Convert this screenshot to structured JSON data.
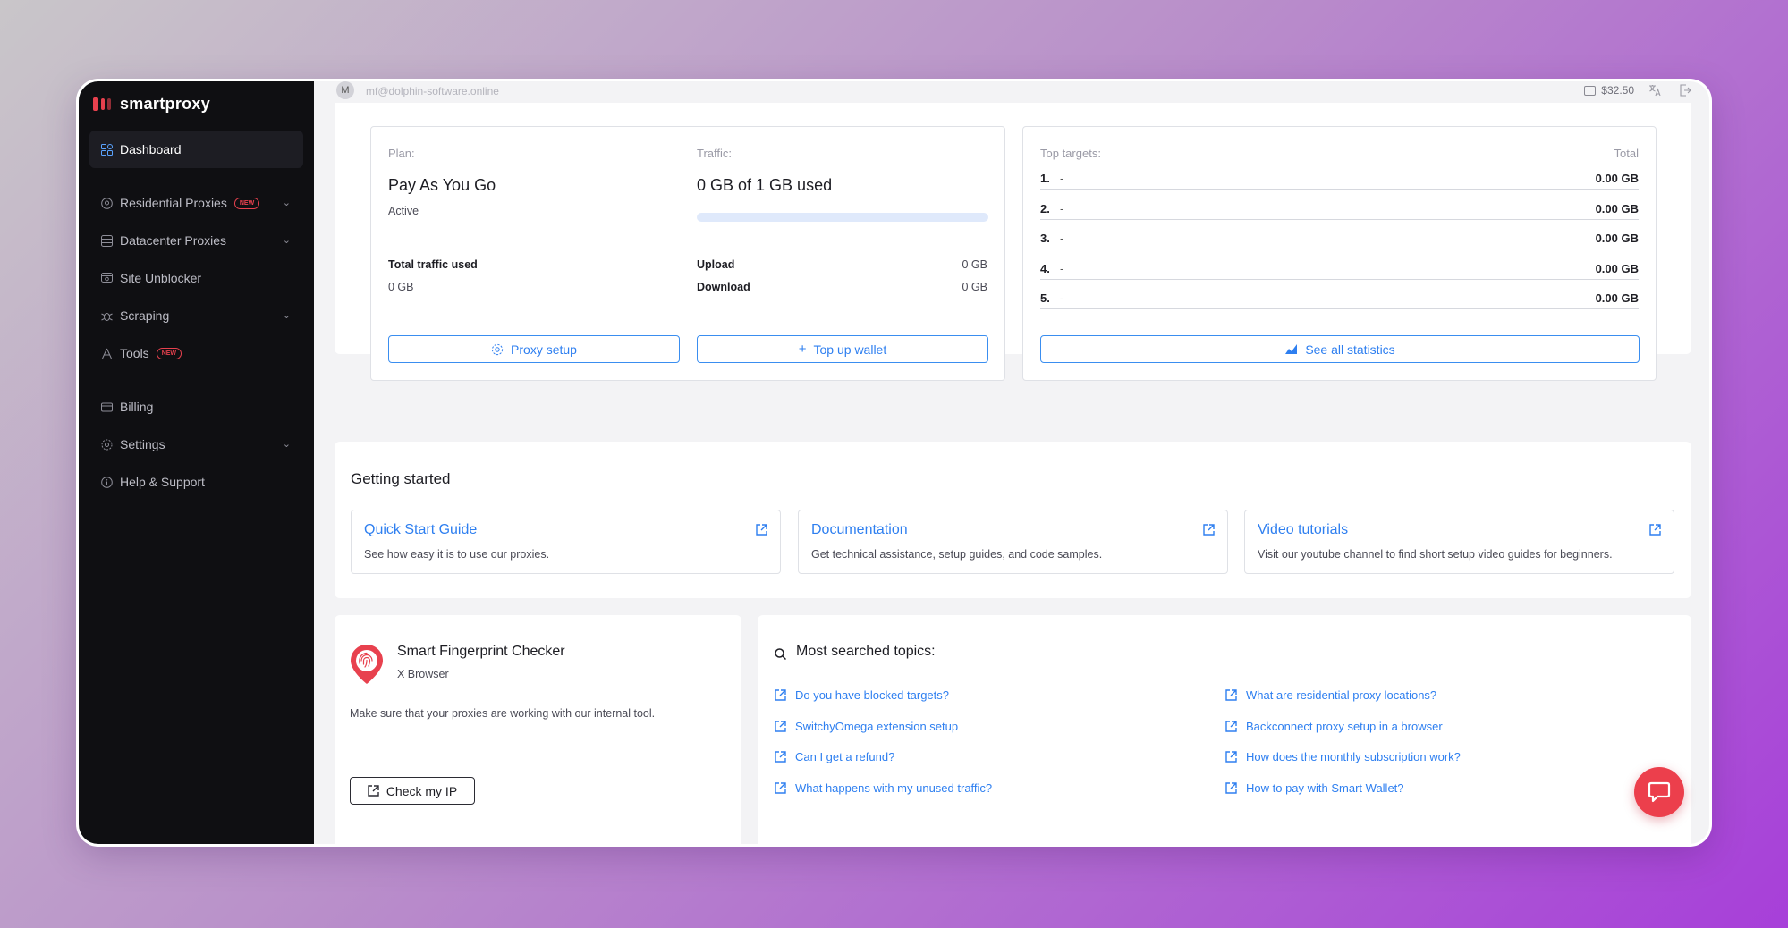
{
  "sidebar": {
    "brand": "smartproxy",
    "items": [
      {
        "label": "Dashboard",
        "icon": "dashboard-icon",
        "active": true
      },
      {
        "label": "Residential Proxies",
        "icon": "location-icon",
        "badge": "NEW",
        "expandable": true
      },
      {
        "label": "Datacenter Proxies",
        "icon": "server-icon",
        "expandable": true
      },
      {
        "label": "Site Unblocker",
        "icon": "unblocker-icon"
      },
      {
        "label": "Scraping",
        "icon": "bug-icon",
        "expandable": true
      },
      {
        "label": "Tools",
        "icon": "tools-icon",
        "badge": "NEW"
      },
      {
        "label": "Billing",
        "icon": "card-icon"
      },
      {
        "label": "Settings",
        "icon": "gear-icon",
        "expandable": true
      },
      {
        "label": "Help & Support",
        "icon": "info-icon"
      }
    ]
  },
  "topbar": {
    "avatar_initial": "M",
    "email": "mf@dolphin-software.online",
    "balance": "$32.50"
  },
  "plan": {
    "plan_label": "Plan:",
    "plan_name": "Pay As You Go",
    "plan_status": "Active",
    "traffic_label": "Traffic:",
    "traffic_used": "0 GB of 1 GB used",
    "traffic_fraction": 0,
    "total_traffic_label": "Total traffic used",
    "total_traffic_value": "0 GB",
    "upload_label": "Upload",
    "upload_value": "0 GB",
    "download_label": "Download",
    "download_value": "0 GB",
    "proxy_setup_button": "Proxy setup",
    "top_up_button": "Top up wallet"
  },
  "targets": {
    "title": "Top targets:",
    "total_label": "Total",
    "rows": [
      {
        "rank": "1.",
        "domain": "-",
        "value": "0.00 GB"
      },
      {
        "rank": "2.",
        "domain": "-",
        "value": "0.00 GB"
      },
      {
        "rank": "3.",
        "domain": "-",
        "value": "0.00 GB"
      },
      {
        "rank": "4.",
        "domain": "-",
        "value": "0.00 GB"
      },
      {
        "rank": "5.",
        "domain": "-",
        "value": "0.00 GB"
      }
    ],
    "see_all_button": "See all statistics"
  },
  "getting_started": {
    "title": "Getting started",
    "cards": [
      {
        "title": "Quick Start Guide",
        "desc": "See how easy it is to use our proxies."
      },
      {
        "title": "Documentation",
        "desc": "Get technical assistance, setup guides, and code samples."
      },
      {
        "title": "Video tutorials",
        "desc": "Visit our youtube channel to find short setup video guides for beginners."
      }
    ]
  },
  "fingerprint": {
    "title": "Smart Fingerprint Checker",
    "subtitle": "X Browser",
    "desc": "Make sure that your proxies are working with our internal tool.",
    "button": "Check my IP"
  },
  "topics": {
    "title": "Most searched topics:",
    "left": [
      "Do you have blocked targets?",
      "SwitchyOmega extension setup",
      "Can I get a refund?",
      "What happens with my unused traffic?"
    ],
    "right": [
      "What are residential proxy locations?",
      "Backconnect proxy setup in a browser",
      "How does the monthly subscription work?",
      "How to pay with Smart Wallet?"
    ]
  },
  "colors": {
    "accent": "#2e7ff0",
    "brand_red": "#e8414e",
    "sidebar_bg": "#0f0f12"
  }
}
